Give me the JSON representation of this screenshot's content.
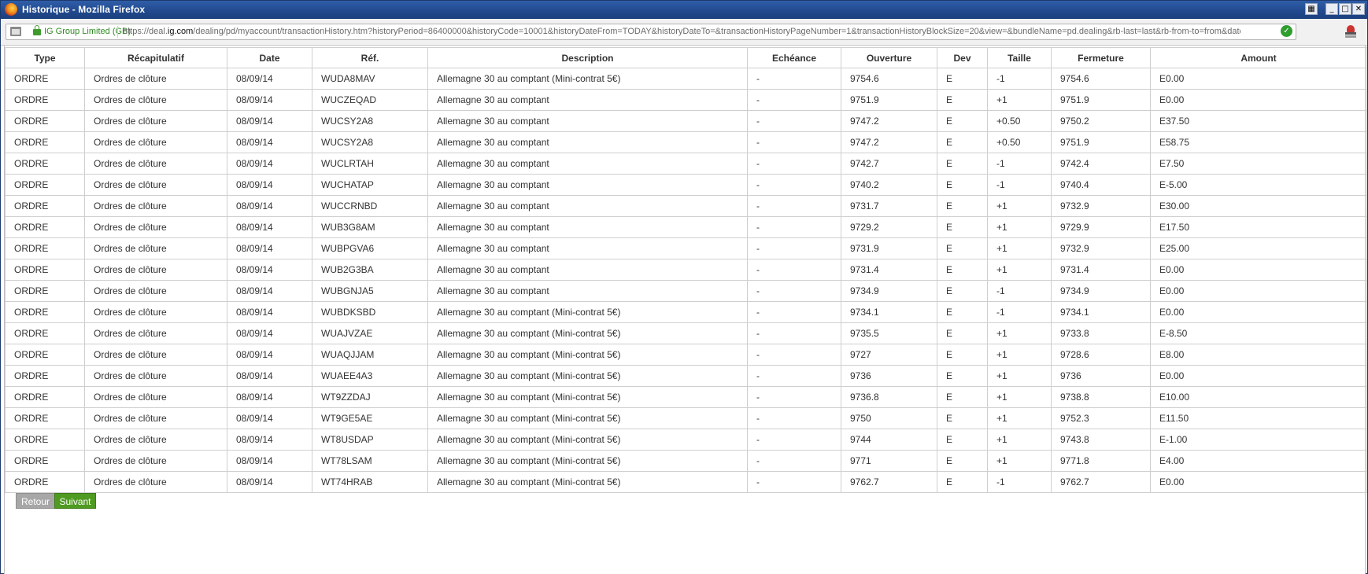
{
  "window": {
    "title": "Historique - Mozilla Firefox",
    "controls": [
      "restore",
      "minimize",
      "maximize",
      "close"
    ]
  },
  "navbar": {
    "identity": "IG Group Limited (GB)",
    "url_prefix": "https://deal.",
    "url_domain": "ig.com",
    "url_rest": "/dealing/pd/myaccount/transactionHistory.htm?historyPeriod=86400000&historyCode=10001&historyDateFrom=TODAY&historyDateTo=&transactionHistoryPageNumber=1&transactionHistoryBlockSize=20&view=&bundleName=pd.dealing&rb-last=last&rb-from-to=from&date-from=jj/mm/a",
    "icons": [
      "page-icon",
      "lock-icon",
      "verified-check-icon",
      "notification-icon"
    ]
  },
  "table": {
    "headers": [
      "Type",
      "Récapitulatif",
      "Date",
      "Réf.",
      "Description",
      "Echéance",
      "Ouverture",
      "Dev",
      "Taille",
      "Fermeture",
      "Amount"
    ],
    "rows": [
      [
        "ORDRE",
        "Ordres de clôture",
        "08/09/14",
        "WUDA8MAV",
        "Allemagne 30 au comptant (Mini-contrat 5€)",
        "-",
        "9754.6",
        "E",
        "-1",
        "9754.6",
        "E0.00"
      ],
      [
        "ORDRE",
        "Ordres de clôture",
        "08/09/14",
        "WUCZEQAD",
        "Allemagne 30 au comptant",
        "-",
        "9751.9",
        "E",
        "+1",
        "9751.9",
        "E0.00"
      ],
      [
        "ORDRE",
        "Ordres de clôture",
        "08/09/14",
        "WUCSY2A8",
        "Allemagne 30 au comptant",
        "-",
        "9747.2",
        "E",
        "+0.50",
        "9750.2",
        "E37.50"
      ],
      [
        "ORDRE",
        "Ordres de clôture",
        "08/09/14",
        "WUCSY2A8",
        "Allemagne 30 au comptant",
        "-",
        "9747.2",
        "E",
        "+0.50",
        "9751.9",
        "E58.75"
      ],
      [
        "ORDRE",
        "Ordres de clôture",
        "08/09/14",
        "WUCLRTAH",
        "Allemagne 30 au comptant",
        "-",
        "9742.7",
        "E",
        "-1",
        "9742.4",
        "E7.50"
      ],
      [
        "ORDRE",
        "Ordres de clôture",
        "08/09/14",
        "WUCHATAP",
        "Allemagne 30 au comptant",
        "-",
        "9740.2",
        "E",
        "-1",
        "9740.4",
        "E-5.00"
      ],
      [
        "ORDRE",
        "Ordres de clôture",
        "08/09/14",
        "WUCCRNBD",
        "Allemagne 30 au comptant",
        "-",
        "9731.7",
        "E",
        "+1",
        "9732.9",
        "E30.00"
      ],
      [
        "ORDRE",
        "Ordres de clôture",
        "08/09/14",
        "WUB3G8AM",
        "Allemagne 30 au comptant",
        "-",
        "9729.2",
        "E",
        "+1",
        "9729.9",
        "E17.50"
      ],
      [
        "ORDRE",
        "Ordres de clôture",
        "08/09/14",
        "WUBPGVA6",
        "Allemagne 30 au comptant",
        "-",
        "9731.9",
        "E",
        "+1",
        "9732.9",
        "E25.00"
      ],
      [
        "ORDRE",
        "Ordres de clôture",
        "08/09/14",
        "WUB2G3BA",
        "Allemagne 30 au comptant",
        "-",
        "9731.4",
        "E",
        "+1",
        "9731.4",
        "E0.00"
      ],
      [
        "ORDRE",
        "Ordres de clôture",
        "08/09/14",
        "WUBGNJA5",
        "Allemagne 30 au comptant",
        "-",
        "9734.9",
        "E",
        "-1",
        "9734.9",
        "E0.00"
      ],
      [
        "ORDRE",
        "Ordres de clôture",
        "08/09/14",
        "WUBDKSBD",
        "Allemagne 30 au comptant (Mini-contrat 5€)",
        "-",
        "9734.1",
        "E",
        "-1",
        "9734.1",
        "E0.00"
      ],
      [
        "ORDRE",
        "Ordres de clôture",
        "08/09/14",
        "WUAJVZAE",
        "Allemagne 30 au comptant (Mini-contrat 5€)",
        "-",
        "9735.5",
        "E",
        "+1",
        "9733.8",
        "E-8.50"
      ],
      [
        "ORDRE",
        "Ordres de clôture",
        "08/09/14",
        "WUAQJJAM",
        "Allemagne 30 au comptant (Mini-contrat 5€)",
        "-",
        "9727",
        "E",
        "+1",
        "9728.6",
        "E8.00"
      ],
      [
        "ORDRE",
        "Ordres de clôture",
        "08/09/14",
        "WUAEE4A3",
        "Allemagne 30 au comptant (Mini-contrat 5€)",
        "-",
        "9736",
        "E",
        "+1",
        "9736",
        "E0.00"
      ],
      [
        "ORDRE",
        "Ordres de clôture",
        "08/09/14",
        "WT9ZZDAJ",
        "Allemagne 30 au comptant (Mini-contrat 5€)",
        "-",
        "9736.8",
        "E",
        "+1",
        "9738.8",
        "E10.00"
      ],
      [
        "ORDRE",
        "Ordres de clôture",
        "08/09/14",
        "WT9GE5AE",
        "Allemagne 30 au comptant (Mini-contrat 5€)",
        "-",
        "9750",
        "E",
        "+1",
        "9752.3",
        "E11.50"
      ],
      [
        "ORDRE",
        "Ordres de clôture",
        "08/09/14",
        "WT8USDAP",
        "Allemagne 30 au comptant (Mini-contrat 5€)",
        "-",
        "9744",
        "E",
        "+1",
        "9743.8",
        "E-1.00"
      ],
      [
        "ORDRE",
        "Ordres de clôture",
        "08/09/14",
        "WT78LSAM",
        "Allemagne 30 au comptant (Mini-contrat 5€)",
        "-",
        "9771",
        "E",
        "+1",
        "9771.8",
        "E4.00"
      ],
      [
        "ORDRE",
        "Ordres de clôture",
        "08/09/14",
        "WT74HRAB",
        "Allemagne 30 au comptant (Mini-contrat 5€)",
        "-",
        "9762.7",
        "E",
        "-1",
        "9762.7",
        "E0.00"
      ]
    ]
  },
  "pagination": {
    "back_label": "Retour",
    "next_label": "Suivant"
  },
  "colors": {
    "title_bar": "#224a8f",
    "identity_green": "#2e8a22",
    "next_button": "#4f9a21",
    "back_button": "#a7a7a7",
    "grid_border": "#cfcfcf"
  }
}
